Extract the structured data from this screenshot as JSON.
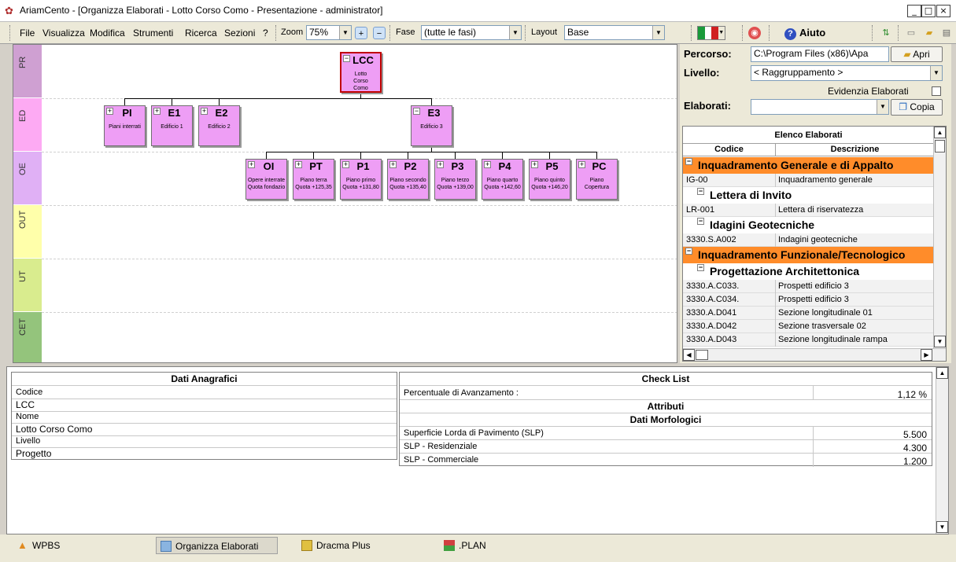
{
  "window": {
    "title": "AriamCento - [Organizza Elaborati - Lotto Corso Como - Presentazione - administrator]",
    "min_label": "_",
    "max_label": "□",
    "close_label": "×"
  },
  "menu": {
    "items": [
      "File",
      "Visualizza",
      "Modifica",
      "Strumenti",
      "Ricerca",
      "Sezioni",
      "?"
    ],
    "zoom_label": "Zoom",
    "zoom_value": "75%",
    "fase_label": "Fase",
    "fase_value": "(tutte le fasi)",
    "layout_label": "Layout",
    "layout_value": "Base",
    "help_label": "Aiuto"
  },
  "diagram": {
    "bands": [
      {
        "label": "PR",
        "color": "#cfa0d2"
      },
      {
        "label": "ED",
        "color": "#fdaaf3"
      },
      {
        "label": "OE",
        "color": "#e0b0f5"
      },
      {
        "label": "OUT",
        "color": "#ffffaa"
      },
      {
        "label": "UT",
        "color": "#d9ec8e"
      },
      {
        "label": "CET",
        "color": "#94c47c"
      }
    ],
    "nodes": [
      {
        "code": "LCC",
        "desc": "Lotto\nCorso\nComo",
        "toggle": "−"
      },
      {
        "code": "PI",
        "desc": "Piani interrati",
        "toggle": "+"
      },
      {
        "code": "E1",
        "desc": "Edificio 1",
        "toggle": "+"
      },
      {
        "code": "E2",
        "desc": "Edificio 2",
        "toggle": "+"
      },
      {
        "code": "E3",
        "desc": "Edificio 3",
        "toggle": "−"
      },
      {
        "code": "OI",
        "desc": "Opere interrate\nQuota fondazio",
        "toggle": "+"
      },
      {
        "code": "PT",
        "desc": "Piano terra\nQuota +125,35",
        "toggle": "+"
      },
      {
        "code": "P1",
        "desc": "Piano primo\nQuota +131,80",
        "toggle": "+"
      },
      {
        "code": "P2",
        "desc": "Piano secondo\nQuota +135,40",
        "toggle": "+"
      },
      {
        "code": "P3",
        "desc": "Piano terzo\nQuota +139,00",
        "toggle": "+"
      },
      {
        "code": "P4",
        "desc": "Piano quarto\nQuota +142,60",
        "toggle": "+"
      },
      {
        "code": "P5",
        "desc": "Piano quinto\nQuota +146,20",
        "toggle": "+"
      },
      {
        "code": "PC",
        "desc": "Piano\nCopertura",
        "toggle": "+"
      }
    ]
  },
  "right": {
    "percorso_label": "Percorso:",
    "percorso_value": "C:\\Program Files (x86)\\Apa",
    "apri_label": "Apri",
    "livello_label": "Livello:",
    "livello_value": "< Raggruppamento >",
    "evidenzia_label": "Evidenzia Elaborati",
    "elaborati_label": "Elaborati:",
    "copia_label": "Copia",
    "list_title": "Elenco Elaborati",
    "col_codice": "Codice",
    "col_descrizione": "Descrizione",
    "orange": "#ff8c2a",
    "rows": [
      {
        "type": "group",
        "style": "orange",
        "text": "Inquadramento Generale e di Appalto"
      },
      {
        "type": "row",
        "code": "IG-00",
        "desc": "Inquadramento generale"
      },
      {
        "type": "group",
        "style": "sub",
        "text": "Lettera di Invito"
      },
      {
        "type": "row",
        "code": "LR-001",
        "desc": "Lettera di riservatezza"
      },
      {
        "type": "group",
        "style": "sub",
        "text": "Idagini Geotecniche"
      },
      {
        "type": "row",
        "code": "3330.S.A002",
        "desc": "Indagini geotecniche"
      },
      {
        "type": "group",
        "style": "orange",
        "text": "Inquadramento Funzionale/Tecnologico"
      },
      {
        "type": "group",
        "style": "sub",
        "text": "Progettazione Architettonica"
      },
      {
        "type": "row",
        "code": "3330.A.C033.",
        "desc": "Prospetti edificio 3"
      },
      {
        "type": "row",
        "code": "3330.A.C034.",
        "desc": "Prospetti edificio 3"
      },
      {
        "type": "row",
        "code": "3330.A.D041",
        "desc": "Sezione longitudinale 01"
      },
      {
        "type": "row",
        "code": "3330.A.D042",
        "desc": "Sezione trasversale 02"
      },
      {
        "type": "row",
        "code": "3330.A.D043",
        "desc": "Sezione longitudinale rampa"
      }
    ]
  },
  "anagrafici": {
    "title": "Dati Anagrafici",
    "fields": [
      {
        "label": "Codice",
        "value": "LCC"
      },
      {
        "label": "Nome",
        "value": "Lotto Corso Como"
      },
      {
        "label": "Livello",
        "value": "Progetto"
      }
    ]
  },
  "checklist": {
    "title": "Check List",
    "percent_label": "Percentuale di Avanzamento :",
    "percent_value": "1,12 %",
    "attributi_title": "Attributi",
    "morfologici_title": "Dati Morfologici",
    "rows": [
      {
        "label": "Superficie Lorda di Pavimento (SLP)",
        "value": "5.500"
      },
      {
        "label": "SLP - Residenziale",
        "value": "4.300"
      },
      {
        "label": "SLP - Commerciale",
        "value": "1.200"
      }
    ]
  },
  "tabs": [
    "WPBS",
    "Organizza Elaborati",
    "Dracma Plus",
    ".PLAN"
  ]
}
